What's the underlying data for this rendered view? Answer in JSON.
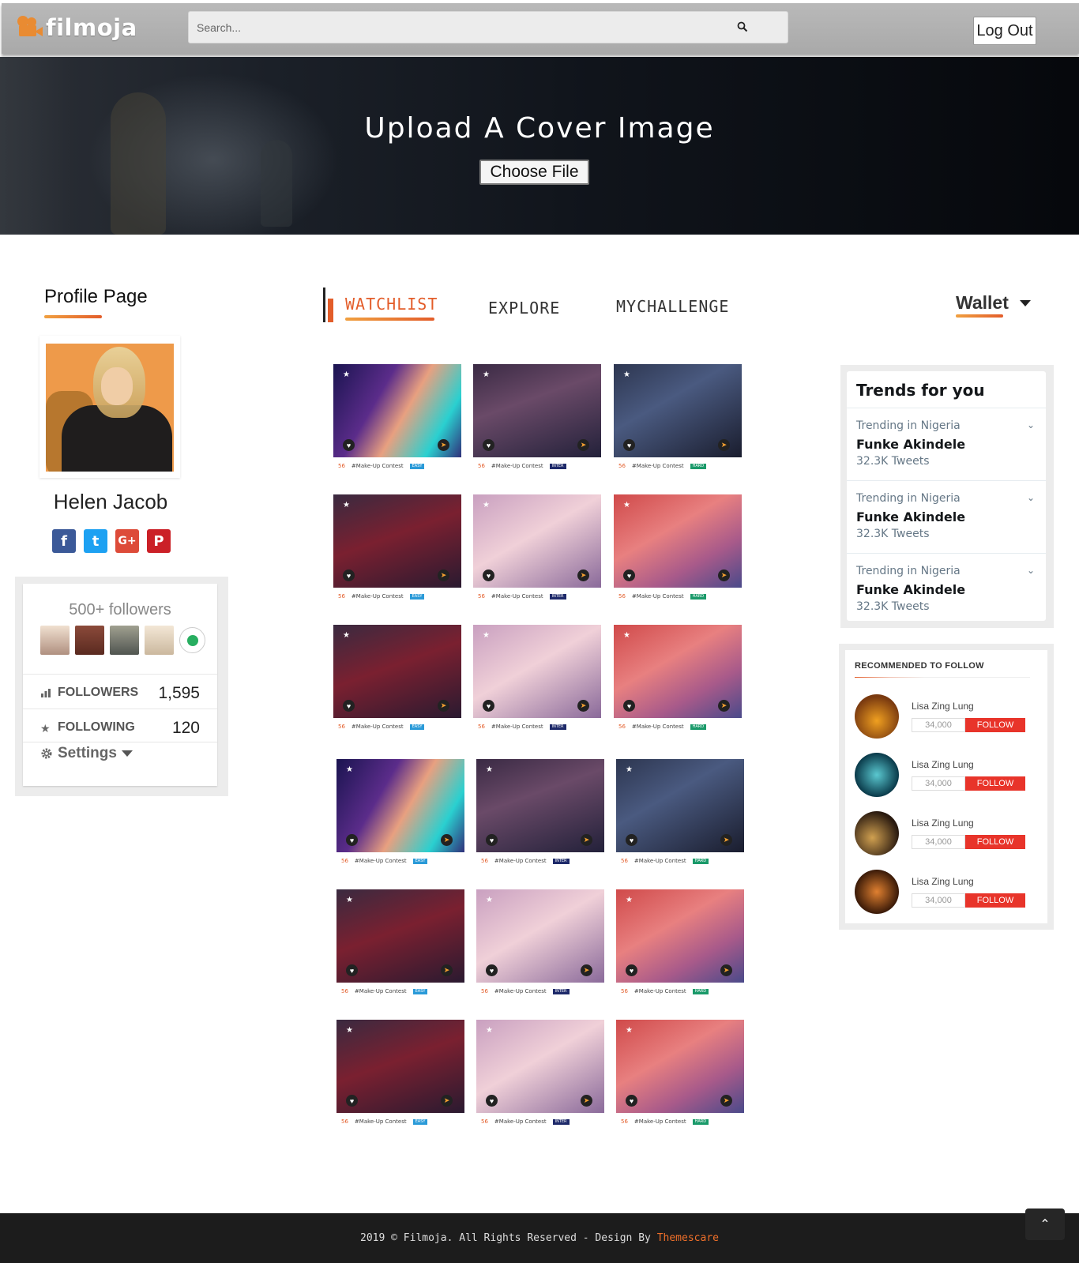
{
  "header": {
    "logo_text": "filmoja",
    "search_placeholder": "Search...",
    "logout_label": "Log Out"
  },
  "cover": {
    "title": "Upload A Cover Image",
    "choose_file_label": "Choose File"
  },
  "profile": {
    "section_title": "Profile Page",
    "name": "Helen Jacob",
    "socials": [
      {
        "name": "facebook",
        "glyph": "f"
      },
      {
        "name": "twitter",
        "glyph": "t"
      },
      {
        "name": "google-plus",
        "glyph": "G+"
      },
      {
        "name": "pinterest",
        "glyph": "P"
      }
    ],
    "followers_title": "500+ followers",
    "stats": [
      {
        "label": "FOLLOWERS",
        "value": "1,595"
      },
      {
        "label": "FOLLOWING",
        "value": "120"
      }
    ],
    "settings_label": "Settings"
  },
  "tabs": [
    {
      "label": "WATCHLIST",
      "active": true
    },
    {
      "label": "EXPLORE",
      "active": false
    },
    {
      "label": "MYCHALLENGE",
      "active": false
    }
  ],
  "wallet_label": "Wallet",
  "grid": {
    "meta_count": "56",
    "meta_tag": "#Make-Up Contest",
    "badges": {
      "easy": "EASY",
      "inter": "INTER",
      "hard": "HARD"
    },
    "rows": [
      [
        "neon",
        "cafe",
        "gym"
      ],
      [
        "car",
        "lip",
        "phone"
      ],
      [
        "car",
        "lip",
        "phone"
      ],
      [
        "neon",
        "cafe",
        "gym"
      ],
      [
        "car",
        "lip",
        "phone"
      ],
      [
        "car",
        "lip",
        "phone"
      ]
    ]
  },
  "trends": {
    "title": "Trends for you",
    "items": [
      {
        "context": "Trending in Nigeria",
        "name": "Funke Akindele",
        "count": "32.3K Tweets"
      },
      {
        "context": "Trending in Nigeria",
        "name": "Funke Akindele",
        "count": "32.3K Tweets"
      },
      {
        "context": "Trending in Nigeria",
        "name": "Funke Akindele",
        "count": "32.3K Tweets"
      }
    ]
  },
  "recommended": {
    "title": "RECOMMENDED TO FOLLOW",
    "items": [
      {
        "name": "Lisa Zing Lung",
        "count": "34,000",
        "follow": "FOLLOW"
      },
      {
        "name": "Lisa Zing Lung",
        "count": "34,000",
        "follow": "FOLLOW"
      },
      {
        "name": "Lisa Zing Lung",
        "count": "34,000",
        "follow": "FOLLOW"
      },
      {
        "name": "Lisa Zing Lung",
        "count": "34,000",
        "follow": "FOLLOW"
      }
    ]
  },
  "footer": {
    "text": "2019 © Filmoja. All Rights Reserved - Design By ",
    "brand": "Themescare"
  },
  "colors": {
    "accent": "#e35d2a",
    "follow_button": "#e8342a",
    "footer_bg": "#1c1c1c"
  }
}
